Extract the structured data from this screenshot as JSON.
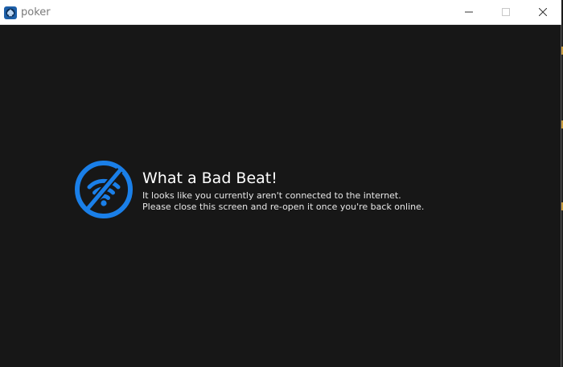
{
  "window": {
    "title": "poker",
    "icon": "poker-app-icon",
    "controls": [
      "minimize-icon",
      "maximize-icon",
      "close-icon"
    ]
  },
  "message": {
    "icon": "no-wifi-icon",
    "heading": "What a Bad Beat!",
    "line1": "It looks like you currently aren't connected to the internet.",
    "line2": "Please close this screen and re-open it once you're back online."
  },
  "colors": {
    "accent": "#1a7fe8",
    "background": "#171717",
    "titlebar": "#ffffff"
  }
}
